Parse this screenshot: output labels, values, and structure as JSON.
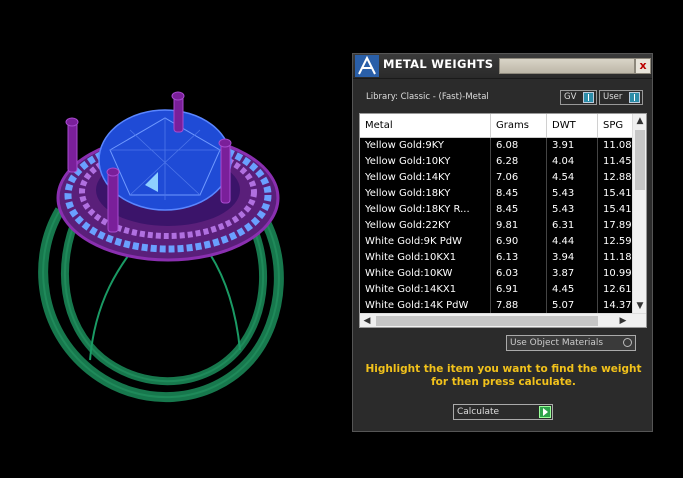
{
  "panel": {
    "title": "METAL WEIGHTS",
    "close_symbol": "x",
    "library": "Library: Classic - (Fast)-Metal",
    "toggle_gv": "GV",
    "toggle_user": "User"
  },
  "table": {
    "columns": [
      "Metal",
      "Grams",
      "DWT",
      "SPG"
    ],
    "rows": [
      [
        "Yellow Gold:9KY",
        "6.08",
        "3.91",
        "11.08"
      ],
      [
        "Yellow Gold:10KY",
        "6.28",
        "4.04",
        "11.45"
      ],
      [
        "Yellow Gold:14KY",
        "7.06",
        "4.54",
        "12.88"
      ],
      [
        "Yellow Gold:18KY",
        "8.45",
        "5.43",
        "15.41"
      ],
      [
        "Yellow Gold:18KY R...",
        "8.45",
        "5.43",
        "15.41"
      ],
      [
        "Yellow Gold:22KY",
        "9.81",
        "6.31",
        "17.89"
      ],
      [
        "White Gold:9K PdW",
        "6.90",
        "4.44",
        "12.59"
      ],
      [
        "White Gold:10KX1",
        "6.13",
        "3.94",
        "11.18"
      ],
      [
        "White Gold:10KW",
        "6.03",
        "3.87",
        "10.99"
      ],
      [
        "White Gold:14KX1",
        "6.91",
        "4.45",
        "12.61"
      ],
      [
        "White Gold:14K PdW",
        "7.88",
        "5.07",
        "14.37"
      ]
    ]
  },
  "use_object_materials_label": "Use Object Materials",
  "hint": "Highlight the item you want to find the weight for then press calculate.",
  "calculate_label": "Calculate",
  "colors": {
    "panel_bg": "#2b2b2b",
    "hint": "#f2c21b",
    "ring_band": "#1f8a5a",
    "prongs": "#7a1f9a",
    "gem": "#1f4bd6"
  }
}
